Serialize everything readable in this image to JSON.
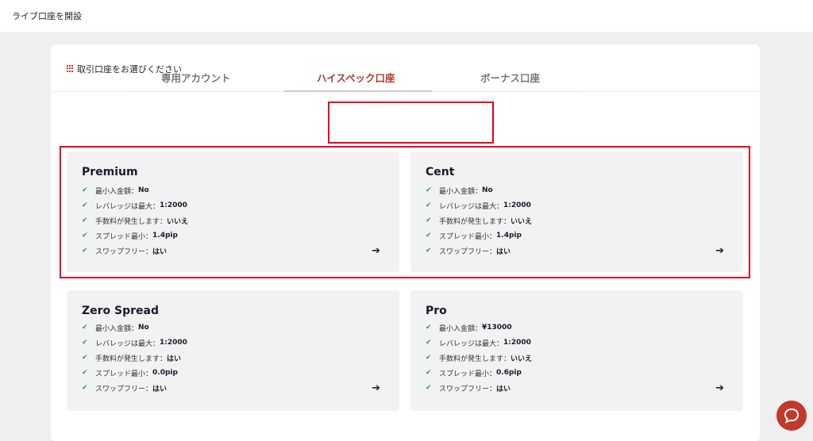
{
  "header": {
    "title": "ライブ口座を開設"
  },
  "panel": {
    "title": "取引口座をお選びください"
  },
  "tabs": [
    {
      "label": "専用アカウント"
    },
    {
      "label": "ハイスペック口座"
    },
    {
      "label": "ボーナス口座"
    }
  ],
  "cards": [
    {
      "name": "Premium",
      "features": [
        {
          "label": "最小入金額：",
          "value": "No"
        },
        {
          "label": "レバレッジは最大： ",
          "value": "1:2000"
        },
        {
          "label": "手数料が発生します：",
          "value": "いいえ"
        },
        {
          "label": "スプレッド最小：",
          "value": "1.4pip"
        },
        {
          "label": "スワップフリー：",
          "value": "はい"
        }
      ]
    },
    {
      "name": "Cent",
      "features": [
        {
          "label": "最小入金額：",
          "value": "No"
        },
        {
          "label": "レバレッジは最大： ",
          "value": "1:2000"
        },
        {
          "label": "手数料が発生します：",
          "value": "いいえ"
        },
        {
          "label": "スプレッド最小：",
          "value": "1.4pip"
        },
        {
          "label": "スワップフリー：",
          "value": "はい"
        }
      ]
    },
    {
      "name": "Zero Spread",
      "features": [
        {
          "label": "最小入金額：",
          "value": "No"
        },
        {
          "label": "レバレッジは最大： ",
          "value": "1:2000"
        },
        {
          "label": "手数料が発生します：",
          "value": "はい"
        },
        {
          "label": "スプレッド最小：",
          "value": "0.0pip"
        },
        {
          "label": "スワップフリー：",
          "value": "はい"
        }
      ]
    },
    {
      "name": "Pro",
      "features": [
        {
          "label": "最小入金額：",
          "value": "¥13000"
        },
        {
          "label": "レバレッジは最大： ",
          "value": "1:2000"
        },
        {
          "label": "手数料が発生します：",
          "value": "いいえ"
        },
        {
          "label": "スプレッド最小：",
          "value": "0.6pip"
        },
        {
          "label": "スワップフリー：",
          "value": "はい"
        }
      ]
    }
  ],
  "icons": {
    "check": "check-icon",
    "arrow": "arrow-right-icon",
    "chat": "chat-bubble-icon",
    "grid": "grid-icon"
  },
  "colors": {
    "accent": "#b03a2e",
    "highlight": "#e3001b",
    "check": "#2e9a4f",
    "chat": "#c0392b"
  }
}
